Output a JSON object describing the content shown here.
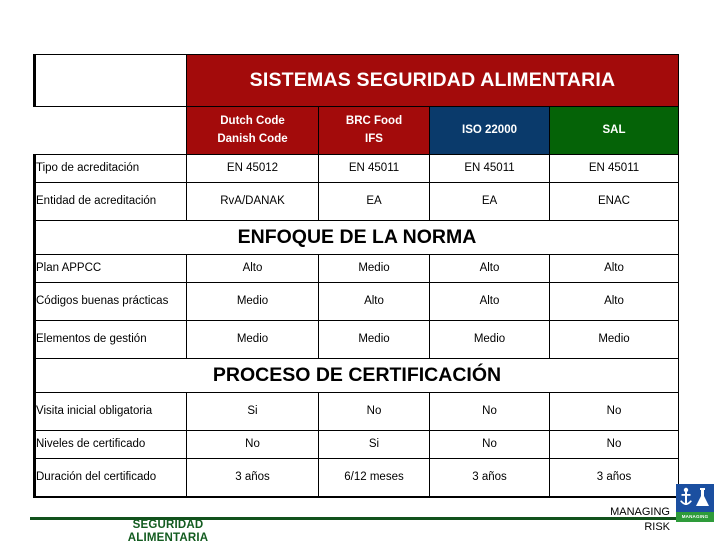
{
  "slide": {
    "banner_title": "SISTEMAS SEGURIDAD ALIMENTARIA",
    "corner_blank": "",
    "colors": {
      "red": "#a30b0b",
      "blue": "#0a3a6b",
      "green": "#056307",
      "footer_green": "#135c20",
      "logo_blue": "#1b4fa0",
      "logo_green": "#2e9b3a"
    }
  },
  "columns": [
    {
      "label_line1": "Dutch Code",
      "label_line2": "Danish Code",
      "color": "red"
    },
    {
      "label_line1": "BRC Food",
      "label_line2": "IFS",
      "color": "red"
    },
    {
      "label_line1": "ISO 22000",
      "label_line2": "",
      "color": "blue"
    },
    {
      "label_line1": "SAL",
      "label_line2": "",
      "color": "green"
    }
  ],
  "top_rows": [
    {
      "label": "Tipo de acreditación",
      "values": [
        "EN 45012",
        "EN 45011",
        "EN 45011",
        "EN 45011"
      ]
    },
    {
      "label": "Entidad de acreditación",
      "values": [
        "RvA/DANAK",
        "EA",
        "EA",
        "ENAC"
      ]
    }
  ],
  "sections": [
    {
      "title": "ENFOQUE DE LA NORMA",
      "rows": [
        {
          "label": "Plan APPCC",
          "values": [
            "Alto",
            "Medio",
            "Alto",
            "Alto"
          ]
        },
        {
          "label": "Códigos buenas prácticas",
          "values": [
            "Medio",
            "Alto",
            "Alto",
            "Alto"
          ]
        },
        {
          "label": "Elementos de gestión",
          "values": [
            "Medio",
            "Medio",
            "Medio",
            "Medio"
          ]
        }
      ]
    },
    {
      "title": "PROCESO DE CERTIFICACIÓN",
      "rows": [
        {
          "label": "Visita inicial obligatoria",
          "values": [
            "Si",
            "No",
            "No",
            "No"
          ]
        },
        {
          "label": "Niveles de certificado",
          "values": [
            "No",
            "Si",
            "No",
            "No"
          ]
        },
        {
          "label": "Duración del certificado",
          "values": [
            "3 años",
            "6/12 meses",
            "3 años",
            "3 años"
          ]
        }
      ]
    }
  ],
  "footer": {
    "left_line1": "SEGURIDAD",
    "left_line2": "ALIMENTARIA",
    "right_line1": "MANAGING",
    "right_line2": "RISK",
    "logo_tag": "MANAGING RISK"
  }
}
